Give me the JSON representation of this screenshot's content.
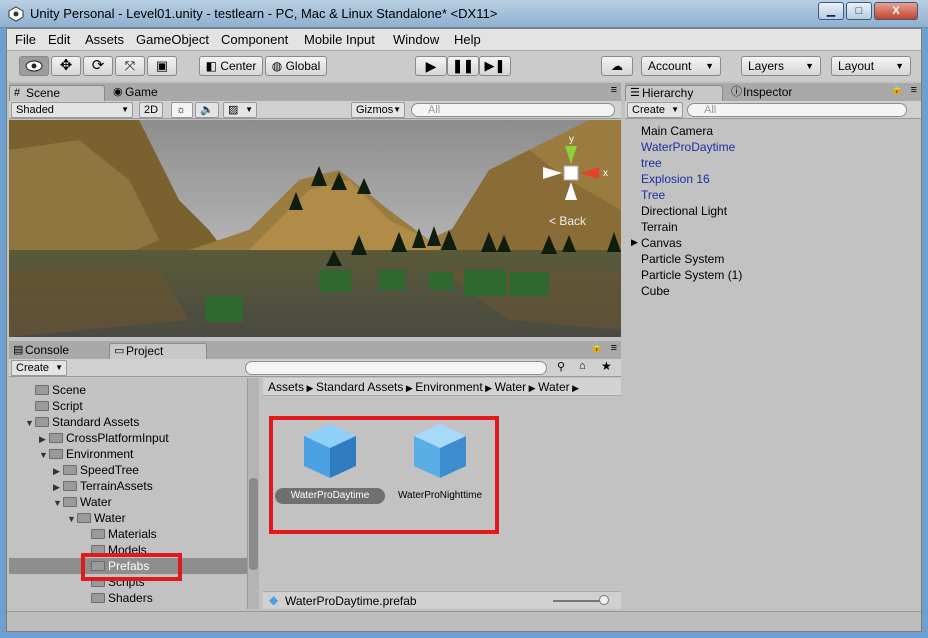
{
  "window": {
    "title": "Unity Personal - Level01.unity - testlearn - PC, Mac & Linux Standalone* <DX11>",
    "minimize": "▁",
    "maximize": "□",
    "close": "X"
  },
  "menu": [
    "File",
    "Edit",
    "Assets",
    "GameObject",
    "Component",
    "Mobile Input",
    "Window",
    "Help"
  ],
  "toolbar": {
    "center": "Center",
    "global": "Global",
    "account": "Account",
    "layers": "Layers",
    "layout": "Layout"
  },
  "scene": {
    "tab_scene": "Scene",
    "tab_game": "Game",
    "shading": "Shaded",
    "mode_2d": "2D",
    "gizmos": "Gizmos",
    "search_placeholder": "All",
    "back_label": "Back",
    "axis_y": "y",
    "axis_x": "x"
  },
  "hierarchy": {
    "tab": "Hierarchy",
    "inspector_tab": "Inspector",
    "create": "Create",
    "search_placeholder": "All",
    "items": [
      {
        "label": "Main Camera",
        "color": "#000000"
      },
      {
        "label": "WaterProDaytime",
        "color": "#1e2fa0"
      },
      {
        "label": "tree",
        "color": "#1e2fa0"
      },
      {
        "label": "Explosion 16",
        "color": "#1e2fa0"
      },
      {
        "label": "Tree",
        "color": "#1e2fa0"
      },
      {
        "label": "Directional Light",
        "color": "#000000"
      },
      {
        "label": "Terrain",
        "color": "#000000"
      },
      {
        "label": "Canvas",
        "color": "#000000"
      },
      {
        "label": "Particle System",
        "color": "#000000"
      },
      {
        "label": "Particle System (1)",
        "color": "#000000"
      },
      {
        "label": "Cube",
        "color": "#000000"
      }
    ]
  },
  "project": {
    "tab_console": "Console",
    "tab_project": "Project",
    "create": "Create",
    "tree": [
      {
        "label": "Scene"
      },
      {
        "label": "Script"
      },
      {
        "label": "Standard Assets"
      },
      {
        "label": "CrossPlatformInput"
      },
      {
        "label": "Environment"
      },
      {
        "label": "SpeedTree"
      },
      {
        "label": "TerrainAssets"
      },
      {
        "label": "Water"
      },
      {
        "label": "Water"
      },
      {
        "label": "Materials"
      },
      {
        "label": "Models"
      },
      {
        "label": "Prefabs"
      },
      {
        "label": "Scripts"
      },
      {
        "label": "Shaders"
      }
    ],
    "breadcrumb": [
      "Assets",
      "Standard Assets",
      "Environment",
      "Water",
      "Water"
    ],
    "assets": [
      {
        "label": "WaterProDaytime"
      },
      {
        "label": "WaterProNighttime"
      }
    ],
    "footer_file": "WaterProDaytime.prefab"
  },
  "colors": {
    "highlight": "#e2191a",
    "selection": "#8e8e8e",
    "prefab_blue": "#4aa0e0"
  }
}
